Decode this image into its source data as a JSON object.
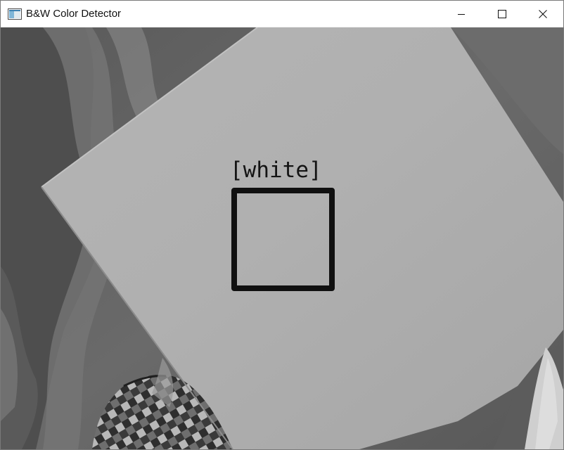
{
  "window": {
    "title": "B&W Color Detector",
    "icon": "app-window-icon",
    "controls": {
      "minimize_icon": "minimize-icon",
      "maximize_icon": "maximize-icon",
      "close_icon": "close-icon"
    }
  },
  "camera_feed": {
    "detection": {
      "label": "[white]",
      "box_color": "#101010"
    }
  }
}
